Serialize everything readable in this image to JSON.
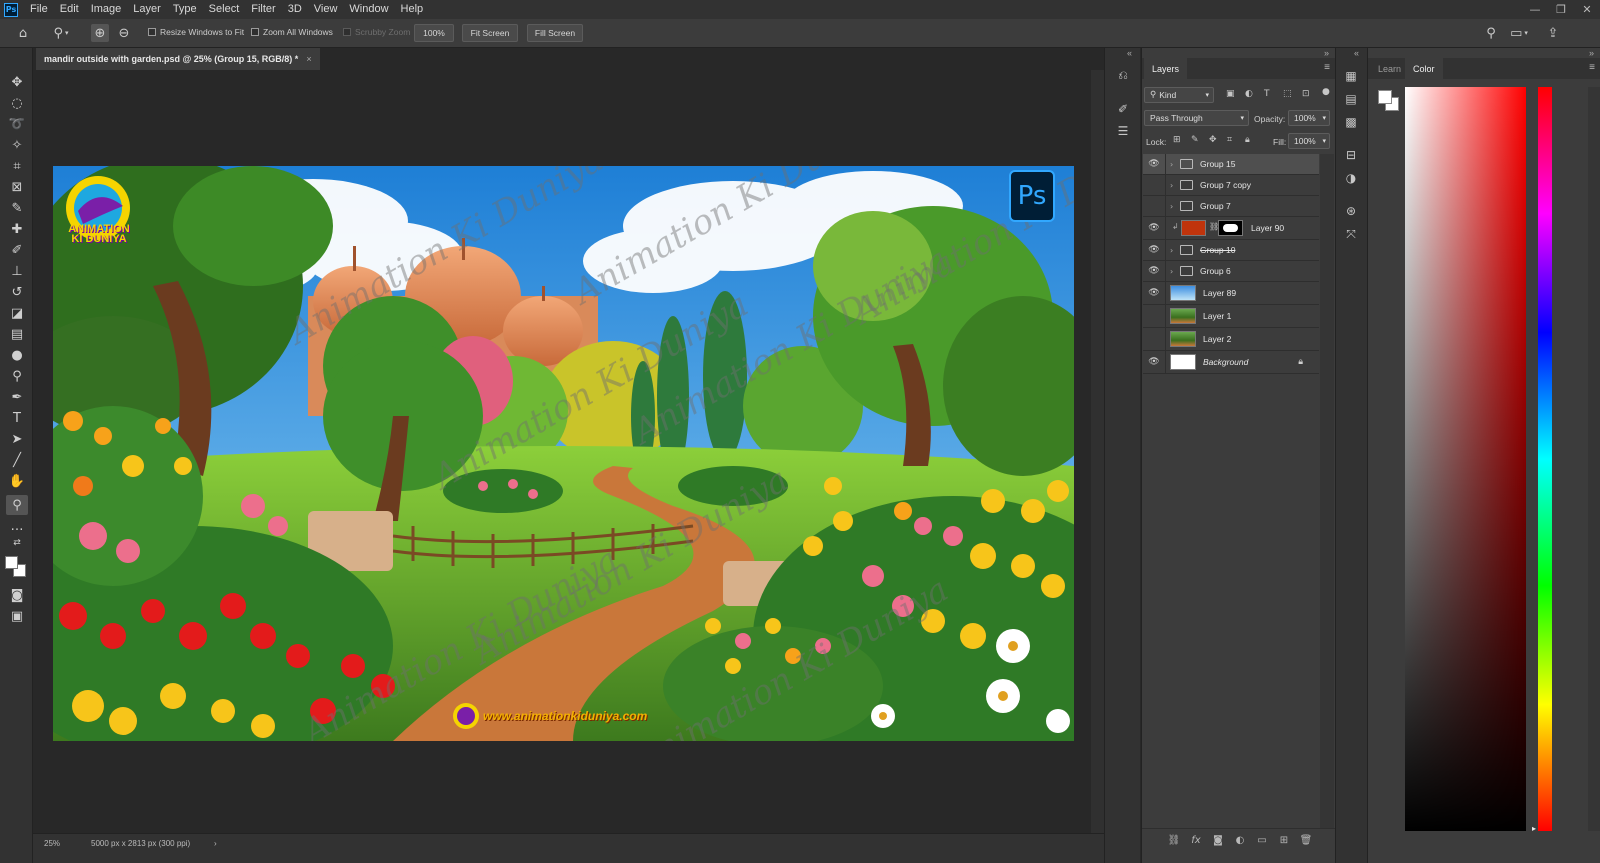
{
  "app": {
    "logo": "Ps"
  },
  "menu": [
    "File",
    "Edit",
    "Image",
    "Layer",
    "Type",
    "Select",
    "Filter",
    "3D",
    "View",
    "Window",
    "Help"
  ],
  "window_controls": {
    "minimize": "—",
    "restore": "❐",
    "close": "✕"
  },
  "options_bar": {
    "resize_windows_to_fit": "Resize Windows to Fit",
    "zoom_all_windows": "Zoom All Windows",
    "scrubby_zoom": "Scrubby Zoom",
    "zoom_value": "100%",
    "fit_screen": "Fit Screen",
    "fill_screen": "Fill Screen"
  },
  "document": {
    "tab_title": "mandir outside with garden.psd @ 25% (Group 15, RGB/8) *",
    "close": "×",
    "artwork": {
      "watermark_text": "Animation Ki Duniya",
      "logo_text": "ANIMATION KI DUNIYA",
      "site_url": "www.animationkiduniya.com",
      "ps_badge": "Ps"
    }
  },
  "status_bar": {
    "zoom": "25%",
    "doc_info": "5000 px x 2813 px (300 ppi)",
    "arrow": "›"
  },
  "layers_panel": {
    "tab": "Layers",
    "filter_kind": "Kind",
    "blend_mode": "Pass Through",
    "opacity_label": "Opacity:",
    "opacity_value": "100%",
    "lock_label": "Lock:",
    "fill_label": "Fill:",
    "fill_value": "100%",
    "layers": [
      {
        "name": "Group 15",
        "type": "group",
        "visible": true,
        "selected": true
      },
      {
        "name": "Group 7 copy",
        "type": "group",
        "visible": false,
        "selected": false
      },
      {
        "name": "Group 7",
        "type": "group",
        "visible": false,
        "selected": false
      },
      {
        "name": "Layer 90",
        "type": "masked",
        "visible": true,
        "selected": false
      },
      {
        "name": "Group 10",
        "type": "group",
        "visible": true,
        "selected": false
      },
      {
        "name": "Group 6",
        "type": "group",
        "visible": true,
        "selected": false
      },
      {
        "name": "Layer 89",
        "type": "pixel",
        "visible": true,
        "selected": false
      },
      {
        "name": "Layer 1",
        "type": "pixel",
        "visible": false,
        "selected": false
      },
      {
        "name": "Layer 2",
        "type": "pixel",
        "visible": false,
        "selected": false
      },
      {
        "name": "Background",
        "type": "background",
        "visible": true,
        "selected": false
      }
    ]
  },
  "color_panel": {
    "tabs": [
      "Learn",
      "Color"
    ],
    "foreground": "#ffffff",
    "background": "#ffffff"
  },
  "colors": {
    "ps_blue": "#31a8ff",
    "layer90_swatch": "#c0340c"
  }
}
